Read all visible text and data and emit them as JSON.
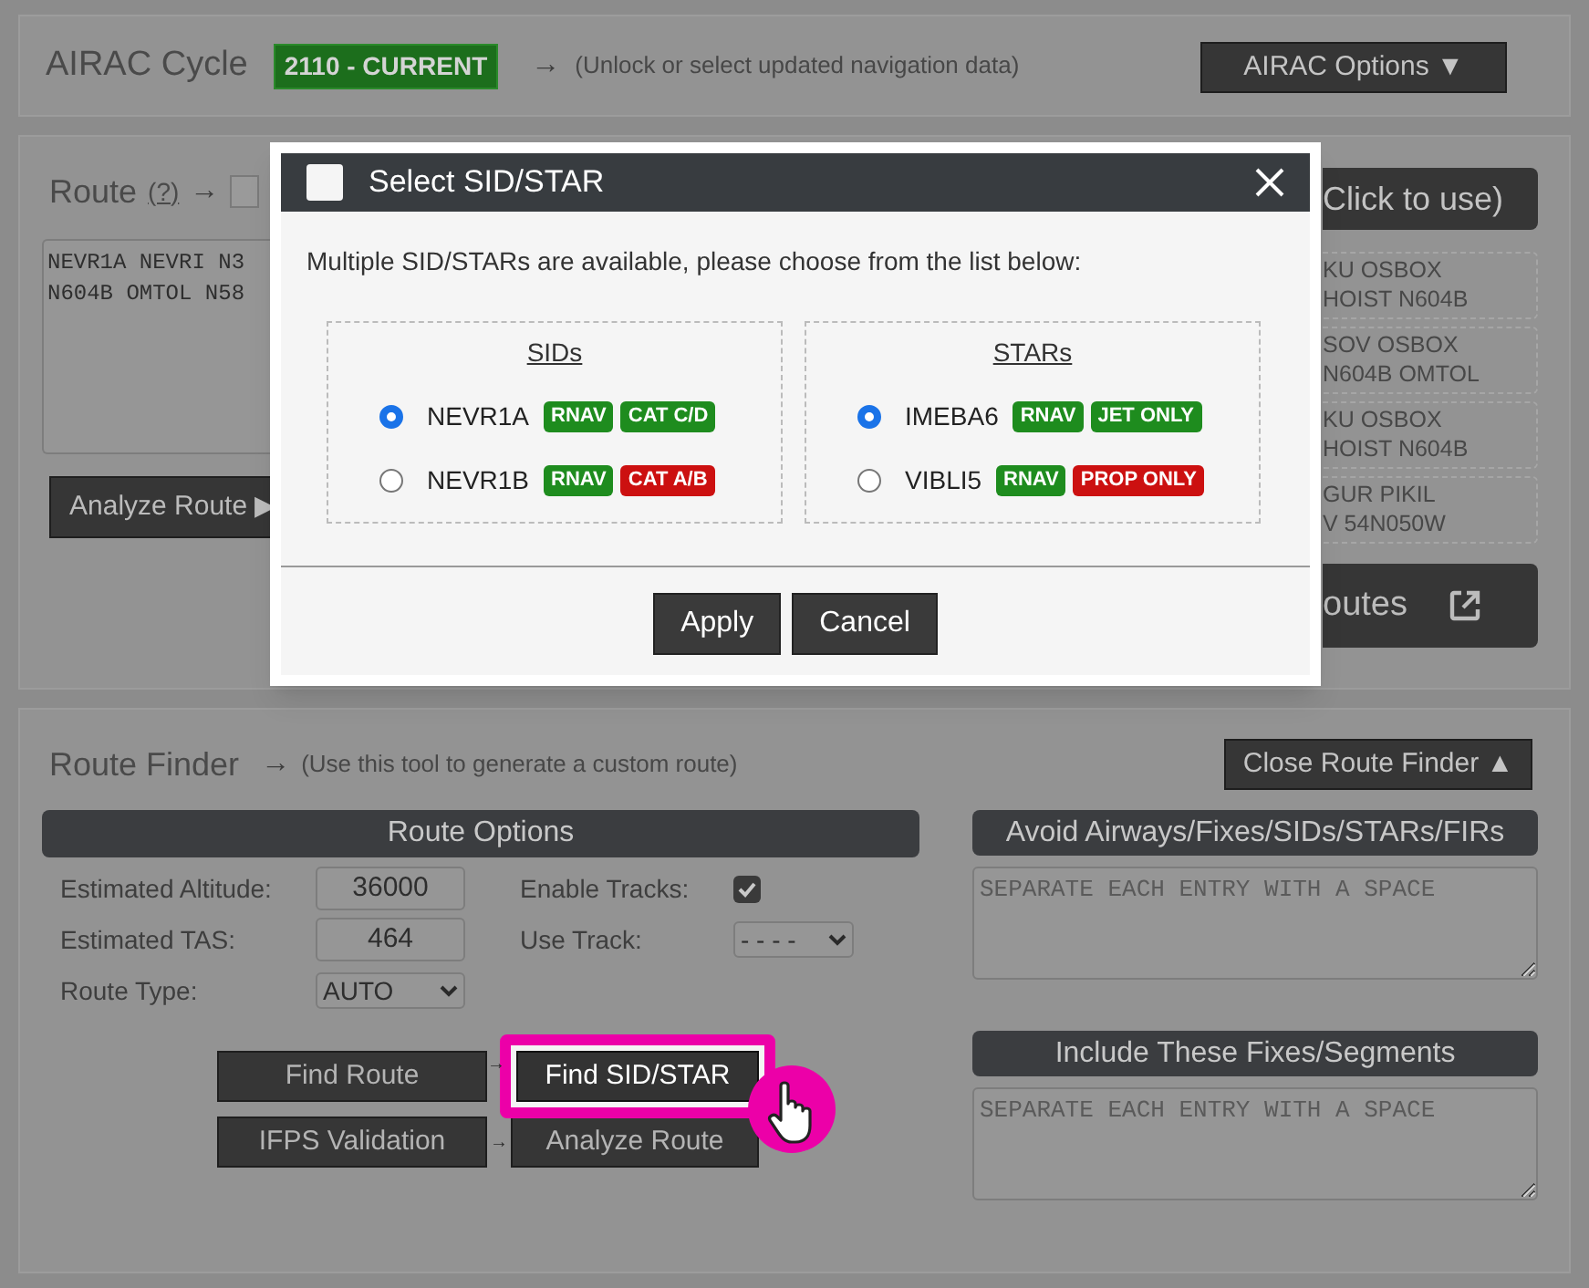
{
  "airac": {
    "title": "AIRAC Cycle",
    "badge": "2110 - CURRENT",
    "arrow": "→",
    "hint": "(Unlock or select updated navigation data)",
    "button": "AIRAC Options ▼"
  },
  "route": {
    "title": "Route",
    "help": "(?)",
    "arrow": "→",
    "text_lines": [
      "NEVR1A NEVRI N3",
      "N604B OMTOL N58"
    ],
    "analyze_button": "Analyze Route ▶",
    "header_button": "Click to use)",
    "suggestions": [
      {
        "lines": [
          "KU OSBOX",
          "HOIST N604B"
        ]
      },
      {
        "lines": [
          "SOV OSBOX",
          "N604B OMTOL"
        ]
      },
      {
        "lines": [
          "KU OSBOX",
          "HOIST N604B"
        ]
      },
      {
        "lines": [
          "GUR PIKIL",
          "V 54N050W"
        ]
      }
    ],
    "routes_button": "outes"
  },
  "dialog": {
    "title": "Select SID/STAR",
    "message": "Multiple SID/STARs are available, please choose from the list below:",
    "groups": [
      {
        "title": "SIDs",
        "options": [
          {
            "name": "NEVR1A",
            "selected": true,
            "tags": [
              {
                "label": "RNAV",
                "color": "#1e8c1e"
              },
              {
                "label": "CAT C/D",
                "color": "#1e8c1e"
              }
            ]
          },
          {
            "name": "NEVR1B",
            "selected": false,
            "tags": [
              {
                "label": "RNAV",
                "color": "#1e8c1e"
              },
              {
                "label": "CAT A/B",
                "color": "#cc1010"
              }
            ]
          }
        ]
      },
      {
        "title": "STARs",
        "options": [
          {
            "name": "IMEBA6",
            "selected": true,
            "tags": [
              {
                "label": "RNAV",
                "color": "#1e8c1e"
              },
              {
                "label": "JET ONLY",
                "color": "#1e8c1e"
              }
            ]
          },
          {
            "name": "VIBLI5",
            "selected": false,
            "tags": [
              {
                "label": "RNAV",
                "color": "#1e8c1e"
              },
              {
                "label": "PROP ONLY",
                "color": "#cc1010"
              }
            ]
          }
        ]
      }
    ],
    "buttons": [
      "Apply",
      "Cancel"
    ]
  },
  "route_finder": {
    "title": "Route Finder",
    "arrow": "→",
    "hint": "(Use this tool to generate a custom route)",
    "close_button": "Close Route Finder ▲",
    "options_title": "Route Options",
    "altitude": {
      "label": "Estimated Altitude:",
      "value": "36000"
    },
    "tas": {
      "label": "Estimated TAS:",
      "value": "464"
    },
    "route_type": {
      "label": "Route Type:",
      "value": "AUTO"
    },
    "enable_tracks": {
      "label": "Enable Tracks:",
      "checked": true
    },
    "use_track": {
      "label": "Use Track:",
      "value": "- - - -"
    },
    "buttons": [
      {
        "label": "Find Route",
        "highlighted": false
      },
      {
        "label": "Find SID/STAR",
        "highlighted": true
      },
      {
        "label": "IFPS Validation",
        "highlighted": false
      },
      {
        "label": "Analyze Route",
        "highlighted": false
      }
    ],
    "arrows": [
      "→",
      "→"
    ],
    "avoid": {
      "title": "Avoid Airways/Fixes/SIDs/STARs/FIRs",
      "placeholder": "SEPARATE EACH ENTRY WITH A SPACE"
    },
    "include": {
      "title": "Include These Fixes/Segments",
      "placeholder": "SEPARATE EACH ENTRY WITH A SPACE"
    }
  }
}
